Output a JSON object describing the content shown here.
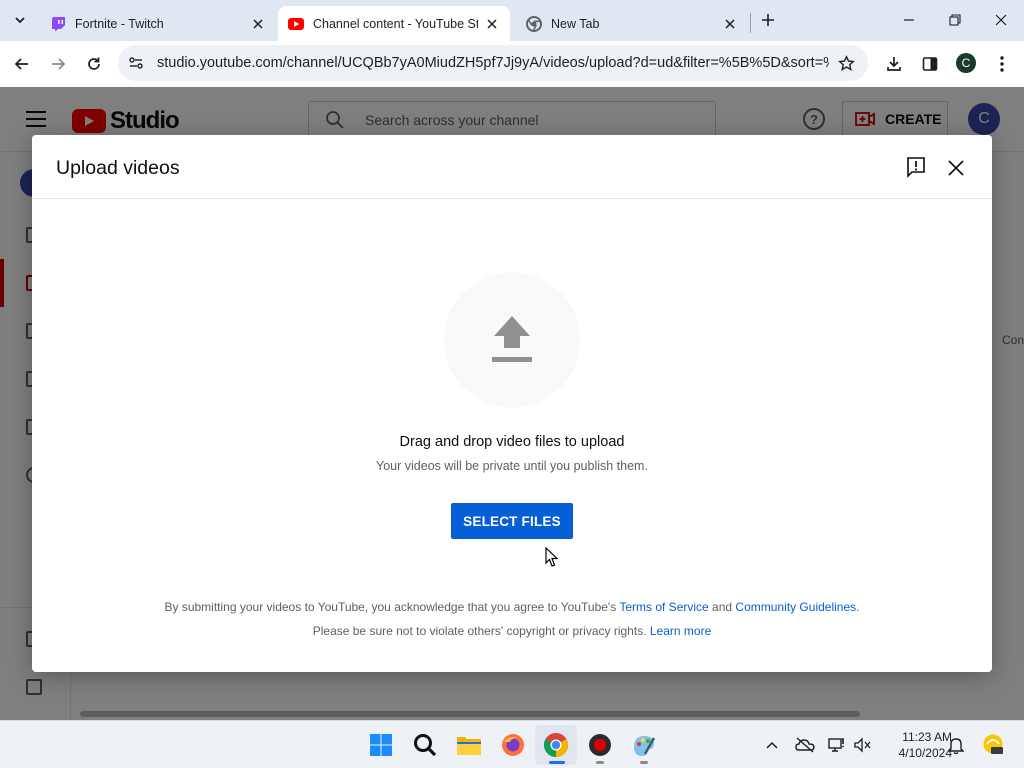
{
  "browser": {
    "tabs": [
      {
        "title": "Fortnite - Twitch",
        "favicon": "twitch-icon",
        "active": false
      },
      {
        "title": "Channel content - YouTube Studio",
        "favicon": "youtube-icon",
        "active": true
      },
      {
        "title": "New Tab",
        "favicon": "chrome-icon",
        "active": false
      }
    ],
    "url": "studio.youtube.com/channel/UCQBb7yA0MiudZH5pf7Jj9yA/videos/upload?d=ud&filter=%5B%5D&sort=%...",
    "profile_initial": "C"
  },
  "studio": {
    "logo_text": "Studio",
    "search_placeholder": "Search across your channel",
    "help_glyph": "?",
    "create_label": "CREATE",
    "avatar_initial": "C",
    "partial_right_text": "Con"
  },
  "dialog": {
    "title": "Upload videos",
    "drag_text": "Drag and drop video files to upload",
    "private_text": "Your videos will be private until you publish them.",
    "select_button": "SELECT FILES",
    "legal_line1_prefix": "By submitting your videos to YouTube, you acknowledge that you agree to YouTube's",
    "terms_link": "Terms of Service",
    "legal_and": "and",
    "guidelines_link": "Community Guidelines",
    "legal_line1_suffix": ".",
    "legal_line2_prefix": "Please be sure not to violate others' copyright or privacy rights.",
    "learn_more_link": "Learn more"
  },
  "taskbar": {
    "time": "11:23 AM",
    "date": "4/10/2024",
    "apps": [
      "windows-start-icon",
      "search-icon",
      "file-explorer-icon",
      "firefox-icon",
      "chrome-icon",
      "obs-icon",
      "paint-icon"
    ]
  },
  "colors": {
    "accent": "#065fd4",
    "youtube_red": "#ff0000",
    "scrim": "rgba(0,0,0,0.5)"
  }
}
